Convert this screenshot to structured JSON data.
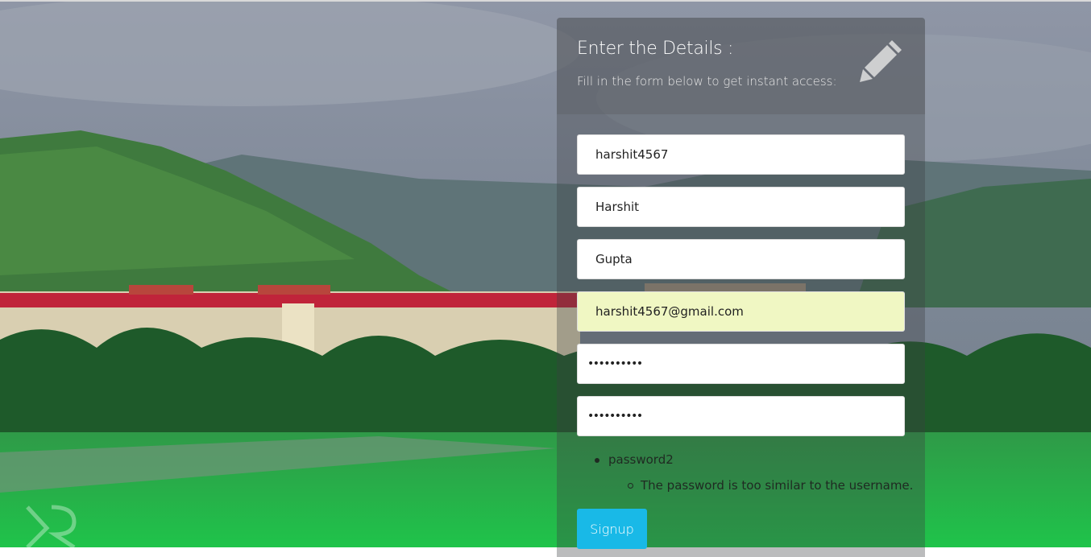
{
  "form": {
    "title": "Enter the Details :",
    "subtitle": "Fill in the form below to get instant access:",
    "fields": {
      "username": "harshit4567",
      "first_name": "Harshit",
      "last_name": "Gupta",
      "email": "harshit4567@gmail.com",
      "password1": "••••••••••",
      "password2": "••••••••••"
    },
    "errors": {
      "field": "password2",
      "message": "The password is too similar to the username."
    },
    "signup_label": "Signup"
  },
  "icons": {
    "header": "pencil-icon",
    "logo": "watermark-logo"
  },
  "colors": {
    "accent": "#19b9e7",
    "autofill": "#f0f7c3"
  }
}
